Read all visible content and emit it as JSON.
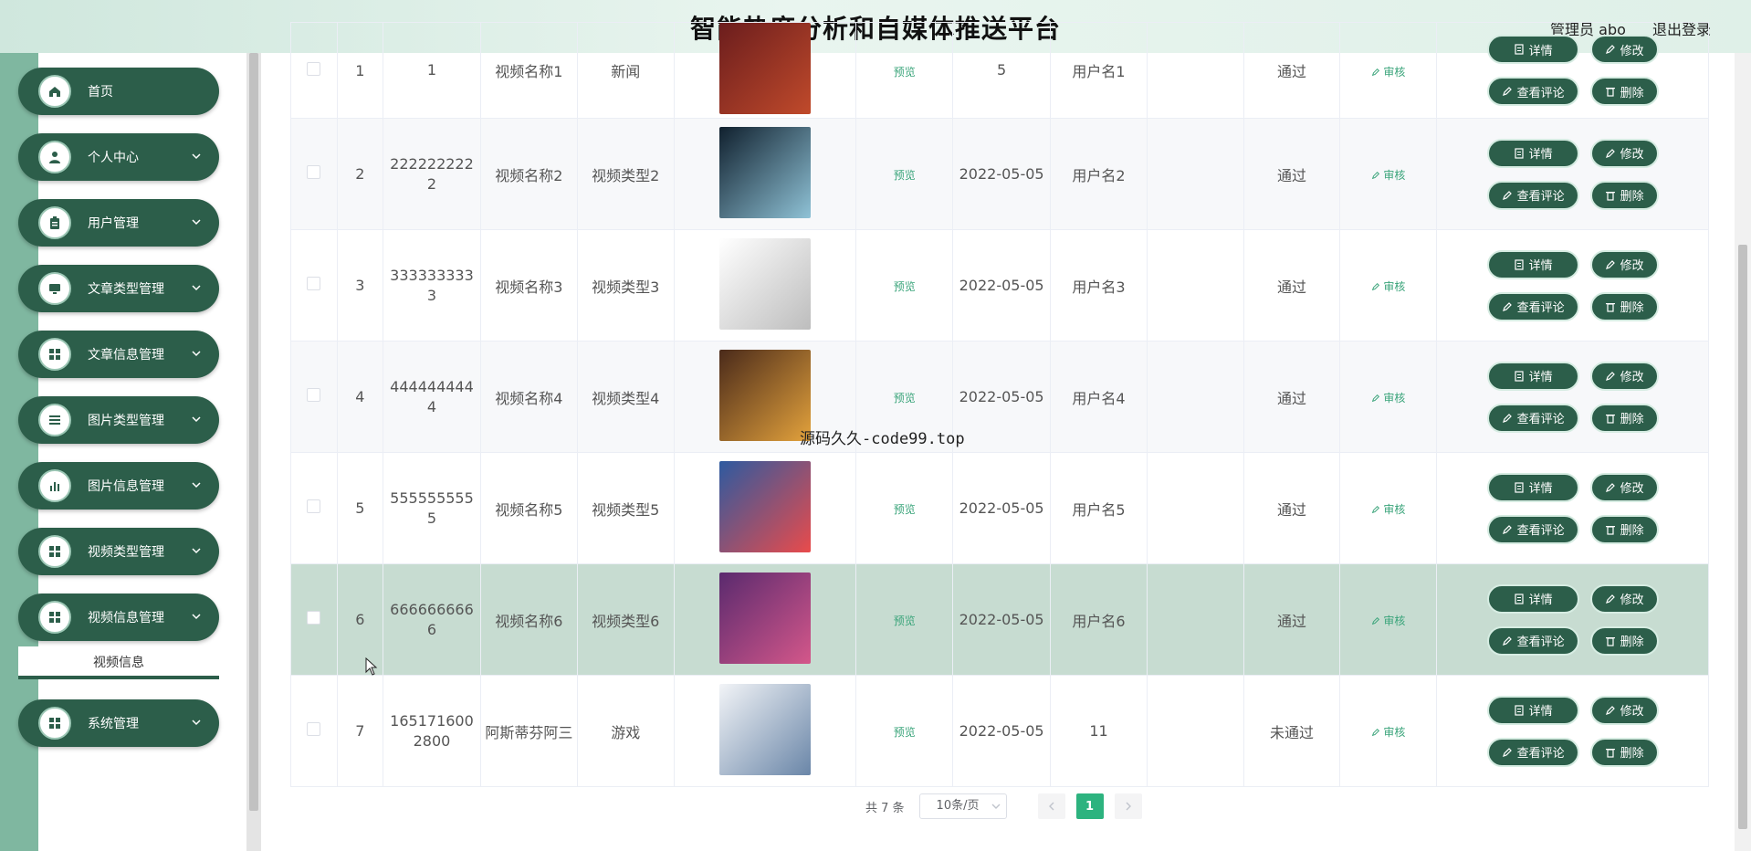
{
  "header": {
    "title": "智能热度分析和自媒体推送平台",
    "user": "管理员 abo",
    "logout": "退出登录"
  },
  "sidebar": {
    "items": [
      {
        "label": "首页",
        "icon": "home-icon",
        "has_arrow": false
      },
      {
        "label": "个人中心",
        "icon": "user-icon",
        "has_arrow": true
      },
      {
        "label": "用户管理",
        "icon": "clipboard-icon",
        "has_arrow": true
      },
      {
        "label": "文章类型管理",
        "icon": "monitor-icon",
        "has_arrow": true
      },
      {
        "label": "文章信息管理",
        "icon": "grid-icon",
        "has_arrow": true
      },
      {
        "label": "图片类型管理",
        "icon": "list-icon",
        "has_arrow": true
      },
      {
        "label": "图片信息管理",
        "icon": "bar-chart-icon",
        "has_arrow": true
      },
      {
        "label": "视频类型管理",
        "icon": "grid-icon",
        "has_arrow": true
      },
      {
        "label": "视频信息管理",
        "icon": "grid-icon",
        "has_arrow": true
      }
    ],
    "submenu": "视频信息",
    "bottom_item": {
      "label": "系统管理",
      "icon": "grid-icon"
    }
  },
  "table": {
    "rows": [
      {
        "index": "1",
        "id": "1",
        "name": "视频名称1",
        "type": "新闻",
        "preview": "预览",
        "date": "5",
        "user": "用户名1",
        "status": "通过",
        "audit": "审核",
        "thumb_colors": [
          "#6b1d1d",
          "#c04a2b"
        ],
        "style": "normal"
      },
      {
        "index": "2",
        "id": "2222222222",
        "name": "视频名称2",
        "type": "视频类型2",
        "preview": "预览",
        "date": "2022-05-05",
        "user": "用户名2",
        "status": "通过",
        "audit": "审核",
        "thumb_colors": [
          "#10202e",
          "#8fc2d6"
        ],
        "style": "alt"
      },
      {
        "index": "3",
        "id": "3333333333",
        "name": "视频名称3",
        "type": "视频类型3",
        "preview": "预览",
        "date": "2022-05-05",
        "user": "用户名3",
        "status": "通过",
        "audit": "审核",
        "thumb_colors": [
          "#ffffff",
          "#bdbdbd"
        ],
        "style": "normal"
      },
      {
        "index": "4",
        "id": "4444444444",
        "name": "视频名称4",
        "type": "视频类型4",
        "preview": "预览",
        "date": "2022-05-05",
        "user": "用户名4",
        "status": "通过",
        "audit": "审核",
        "thumb_colors": [
          "#4a2a1a",
          "#e3a23c"
        ],
        "style": "alt"
      },
      {
        "index": "5",
        "id": "5555555555",
        "name": "视频名称5",
        "type": "视频类型5",
        "preview": "预览",
        "date": "2022-05-05",
        "user": "用户名5",
        "status": "通过",
        "audit": "审核",
        "thumb_colors": [
          "#2d5aa0",
          "#e94b4b"
        ],
        "style": "normal"
      },
      {
        "index": "6",
        "id": "6666666666",
        "name": "视频名称6",
        "type": "视频类型6",
        "preview": "预览",
        "date": "2022-05-05",
        "user": "用户名6",
        "status": "通过",
        "audit": "审核",
        "thumb_colors": [
          "#5a2a6e",
          "#d4578a"
        ],
        "style": "hover"
      },
      {
        "index": "7",
        "id": "1651716002800",
        "name": "阿斯蒂芬阿三",
        "type": "游戏",
        "preview": "预览",
        "date": "2022-05-05",
        "user": "11",
        "status": "未通过",
        "audit": "审核",
        "thumb_colors": [
          "#f2f4f7",
          "#6a86a8"
        ],
        "style": "normal"
      }
    ],
    "buttons": {
      "detail": "详情",
      "edit": "修改",
      "comments": "查看评论",
      "delete": "删除"
    }
  },
  "pager": {
    "total": "共 7 条",
    "page_size": "10条/页",
    "current": "1"
  },
  "overlay_text": "源码久久-code99.top",
  "colors": {
    "primary": "#2c5e4a",
    "accent": "#2db37f",
    "link": "#3aa47a"
  }
}
